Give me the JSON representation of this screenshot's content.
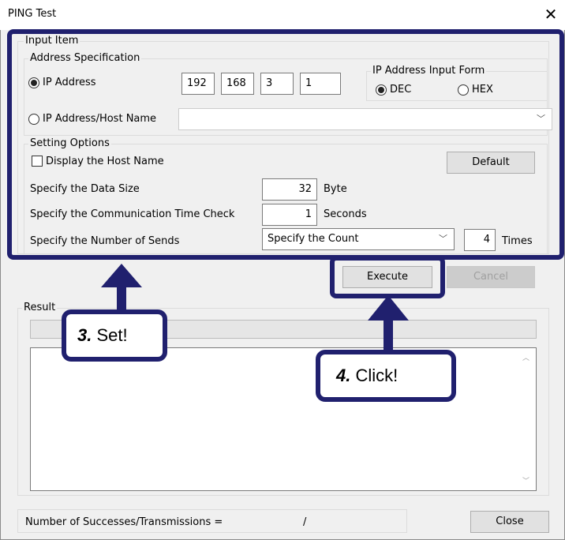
{
  "window": {
    "title": "PING Test",
    "close_glyph": "✕"
  },
  "input_item": {
    "legend": "Input Item",
    "address_spec": {
      "legend": "Address Specification",
      "ip_radio_label": "IP Address",
      "ip_octets": [
        "192",
        "168",
        "3",
        "1"
      ],
      "host_radio_label": "IP Address/Host Name",
      "host_value": "",
      "input_form": {
        "legend": "IP Address Input Form",
        "dec_label": "DEC",
        "hex_label": "HEX",
        "selected": "DEC"
      }
    },
    "setting_options": {
      "legend": "Setting Options",
      "display_host_label": "Display the Host Name",
      "display_host_checked": false,
      "default_button": "Default",
      "data_size_label": "Specify the Data Size",
      "data_size_value": "32",
      "data_size_unit": "Byte",
      "time_check_label": "Specify the Communication Time Check",
      "time_check_value": "1",
      "time_check_unit": "Seconds",
      "sends_label": "Specify the Number of Sends",
      "sends_mode": "Specify the Count",
      "sends_count": "4",
      "sends_unit": "Times"
    }
  },
  "buttons": {
    "execute": "Execute",
    "cancel": "Cancel",
    "close": "Close"
  },
  "result": {
    "legend": "Result",
    "progress_value": 0,
    "output_text": "",
    "summary_label": "Number of Successes/Transmissions =",
    "summary_sep": "/"
  },
  "annotations": {
    "set_num": "3.",
    "set_text": "Set!",
    "click_num": "4.",
    "click_text": "Click!",
    "color": "#20206e"
  }
}
